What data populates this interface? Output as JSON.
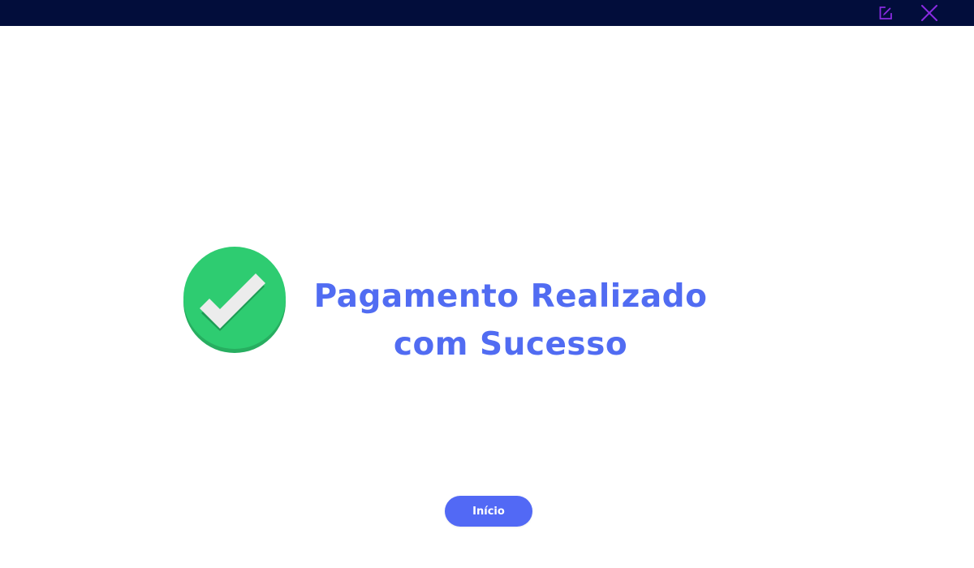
{
  "titlebar": {
    "background": "#020d3b",
    "icon_color": "#8a2be2",
    "buttons": [
      {
        "icon": "edit-icon"
      },
      {
        "icon": "close-icon"
      }
    ]
  },
  "status": {
    "icon": "check-circle-icon",
    "icon_color": "#2ecc71",
    "line1": "Pagamento Realizado",
    "line2": "com Sucesso",
    "text_color": "#516cf2"
  },
  "actions": {
    "home_label": "Início",
    "button_color": "#5269f5"
  }
}
